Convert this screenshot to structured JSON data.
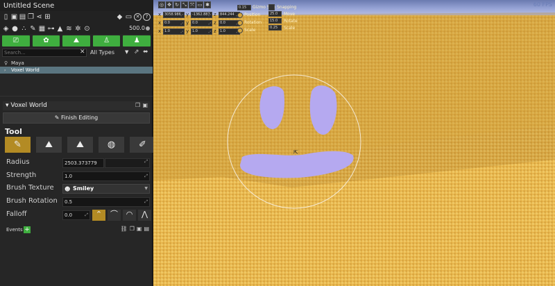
{
  "window": {
    "title": "Untitled Scene"
  },
  "speed": {
    "value": "500.0"
  },
  "search": {
    "placeholder": "Search...",
    "type_filter": "All Types"
  },
  "tree": [
    {
      "label": "Maya",
      "icon": "person-icon"
    },
    {
      "label": "Voxel World",
      "icon": "brush-icon",
      "selected": true
    }
  ],
  "section": {
    "title": "Voxel World",
    "finish_label": "Finish Editing"
  },
  "tool": {
    "heading": "Tool",
    "buttons": [
      "brush",
      "terrain-add",
      "terrain-remove",
      "sphere",
      "paint"
    ]
  },
  "props": {
    "radius_label": "Radius",
    "radius_value": "2503.373779",
    "strength_label": "Strength",
    "strength_value": "1.0",
    "texture_label": "Brush Texture",
    "texture_value": "Smiley",
    "rotation_label": "Brush Rotation",
    "rotation_value": "0.5",
    "falloff_label": "Falloff",
    "falloff_value": "0.0"
  },
  "events": {
    "label": "Events"
  },
  "viewport": {
    "pos": {
      "x": "3058.986",
      "y": "-1362.887",
      "z": "844.244"
    },
    "rot": {
      "x": "0.0",
      "y": "0.0",
      "z": "0.0"
    },
    "scale": {
      "x": "1.0",
      "y": "1.0",
      "z": "1.0"
    },
    "gizmo_size_label": "Gizmo Size",
    "gizmo_size_value": "0.15",
    "position_label": "Position",
    "rotation_label": "Rotation",
    "scale_label": "Scale",
    "snapping_label": "Snapping",
    "snap_move_label": "Move",
    "snap_move_value": "25.0",
    "snap_rotate_label": "Rotate",
    "snap_rotate_value": "15.0",
    "snap_scale_label": "Scale",
    "snap_scale_value": "0.25",
    "fps": "60 FPS"
  },
  "colors": {
    "accent": "#b38b24",
    "green": "#3fae3f",
    "ground": "#e7b348",
    "brush": "#b5a9f0"
  }
}
